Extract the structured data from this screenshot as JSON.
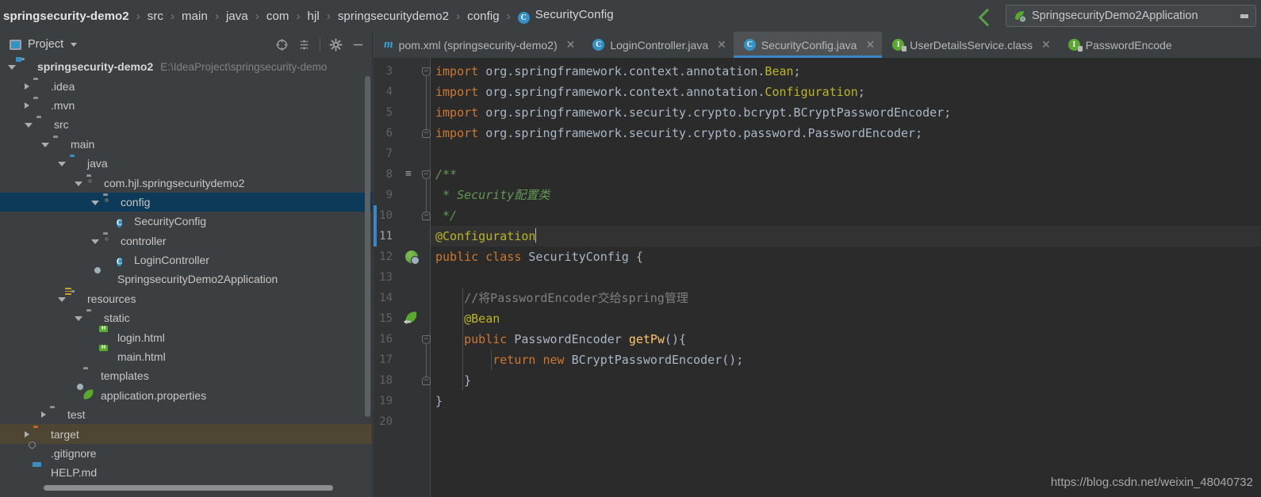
{
  "window": {
    "breadcrumb": [
      {
        "label": "springsecurity-demo2",
        "bold": true,
        "icon": null
      },
      {
        "label": "src",
        "bold": false,
        "icon": null
      },
      {
        "label": "main",
        "bold": false,
        "icon": null
      },
      {
        "label": "java",
        "bold": false,
        "icon": null
      },
      {
        "label": "com",
        "bold": false,
        "icon": null
      },
      {
        "label": "hjl",
        "bold": false,
        "icon": null
      },
      {
        "label": "springsecuritydemo2",
        "bold": false,
        "icon": null
      },
      {
        "label": "config",
        "bold": false,
        "icon": null
      },
      {
        "label": "SecurityConfig",
        "bold": false,
        "icon": "java-class-icon"
      }
    ],
    "separator": "›",
    "run_config": {
      "name": "SpringsecurityDemo2Application",
      "icon": "spring-boot-leaf-icon",
      "dropdown_icon": "chevron-down-icon"
    },
    "back_arrow_icon": "back-arrow-icon"
  },
  "project_panel": {
    "title": "Project",
    "title_icon": "project-window-icon",
    "title_caret": "chevron-down-icon",
    "actions": [
      {
        "name": "select-opened-file-icon",
        "glyph": "⊕"
      },
      {
        "name": "collapse-all-icon",
        "glyph": "≡"
      },
      {
        "name": "settings-gear-icon",
        "glyph": "⚙"
      },
      {
        "name": "hide-panel-icon",
        "glyph": "—"
      }
    ],
    "tree": [
      {
        "label": "springsecurity-demo2",
        "path": "E:\\IdeaProject\\springsecurity-demo",
        "indent": 0,
        "arrow": "open",
        "icon": "module-folder-icon",
        "bold": true,
        "state": "normal"
      },
      {
        "label": ".idea",
        "path": "",
        "indent": 1,
        "arrow": "closed",
        "icon": "folder-icon",
        "bold": false,
        "state": "normal"
      },
      {
        "label": ".mvn",
        "path": "",
        "indent": 1,
        "arrow": "closed",
        "icon": "folder-icon",
        "bold": false,
        "state": "normal"
      },
      {
        "label": "src",
        "path": "",
        "indent": 1,
        "arrow": "open",
        "icon": "folder-icon",
        "bold": false,
        "state": "normal"
      },
      {
        "label": "main",
        "path": "",
        "indent": 2,
        "arrow": "open",
        "icon": "folder-icon",
        "bold": false,
        "state": "normal"
      },
      {
        "label": "java",
        "path": "",
        "indent": 3,
        "arrow": "open",
        "icon": "source-root-folder-icon",
        "bold": false,
        "state": "normal"
      },
      {
        "label": "com.hjl.springsecuritydemo2",
        "path": "",
        "indent": 4,
        "arrow": "open",
        "icon": "package-folder-icon",
        "bold": false,
        "state": "normal"
      },
      {
        "label": "config",
        "path": "",
        "indent": 5,
        "arrow": "open",
        "icon": "package-folder-icon",
        "bold": false,
        "state": "selected"
      },
      {
        "label": "SecurityConfig",
        "path": "",
        "indent": 6,
        "arrow": "none",
        "icon": "java-class-icon",
        "bold": false,
        "state": "normal"
      },
      {
        "label": "controller",
        "path": "",
        "indent": 5,
        "arrow": "open",
        "icon": "package-folder-icon",
        "bold": false,
        "state": "normal"
      },
      {
        "label": "LoginController",
        "path": "",
        "indent": 6,
        "arrow": "none",
        "icon": "java-class-icon",
        "bold": false,
        "state": "normal"
      },
      {
        "label": "SpringsecurityDemo2Application",
        "path": "",
        "indent": 5,
        "arrow": "none",
        "icon": "spring-boot-class-icon",
        "bold": false,
        "state": "normal"
      },
      {
        "label": "resources",
        "path": "",
        "indent": 3,
        "arrow": "open",
        "icon": "resources-folder-icon",
        "bold": false,
        "state": "normal"
      },
      {
        "label": "static",
        "path": "",
        "indent": 4,
        "arrow": "open",
        "icon": "folder-icon",
        "bold": false,
        "state": "normal"
      },
      {
        "label": "login.html",
        "path": "",
        "indent": 5,
        "arrow": "none",
        "icon": "html-file-icon",
        "bold": false,
        "state": "normal"
      },
      {
        "label": "main.html",
        "path": "",
        "indent": 5,
        "arrow": "none",
        "icon": "html-file-icon",
        "bold": false,
        "state": "normal"
      },
      {
        "label": "templates",
        "path": "",
        "indent": 4,
        "arrow": "none",
        "icon": "folder-icon",
        "bold": false,
        "state": "normal"
      },
      {
        "label": "application.properties",
        "path": "",
        "indent": 4,
        "arrow": "none",
        "icon": "spring-properties-icon",
        "bold": false,
        "state": "normal"
      },
      {
        "label": "test",
        "path": "",
        "indent": 2,
        "arrow": "closed",
        "icon": "folder-icon",
        "bold": false,
        "state": "normal"
      },
      {
        "label": "target",
        "path": "",
        "indent": 1,
        "arrow": "closed",
        "icon": "excluded-folder-icon",
        "bold": false,
        "state": "hover"
      },
      {
        "label": ".gitignore",
        "path": "",
        "indent": 1,
        "arrow": "none",
        "icon": "gitignore-file-icon",
        "bold": false,
        "state": "normal"
      },
      {
        "label": "HELP.md",
        "path": "",
        "indent": 1,
        "arrow": "none",
        "icon": "markdown-file-icon",
        "bold": false,
        "state": "normal"
      }
    ]
  },
  "editor": {
    "tabs": [
      {
        "label": "pom.xml (springsecurity-demo2)",
        "icon": "maven-icon",
        "active": false,
        "closable": true
      },
      {
        "label": "LoginController.java",
        "icon": "java-class-icon",
        "active": false,
        "closable": true
      },
      {
        "label": "SecurityConfig.java",
        "icon": "java-class-icon",
        "active": true,
        "closable": true
      },
      {
        "label": "UserDetailsService.class",
        "icon": "java-interface-locked-icon",
        "active": false,
        "closable": true
      },
      {
        "label": "PasswordEncode",
        "icon": "java-interface-locked-icon",
        "active": false,
        "closable": false
      }
    ],
    "first_line_number": 3,
    "last_line_number": 20,
    "current_line": 11,
    "lines": [
      {
        "n": 3,
        "tokens": [
          [
            "k",
            "import "
          ],
          [
            "s",
            "org.springframework.context.annotation."
          ],
          [
            "an",
            "Bean"
          ],
          [
            "s",
            ";"
          ]
        ]
      },
      {
        "n": 4,
        "tokens": [
          [
            "k",
            "import "
          ],
          [
            "s",
            "org.springframework.context.annotation."
          ],
          [
            "an",
            "Configuration"
          ],
          [
            "s",
            ";"
          ]
        ]
      },
      {
        "n": 5,
        "tokens": [
          [
            "k",
            "import "
          ],
          [
            "s",
            "org.springframework.security.crypto.bcrypt.BCryptPasswordEncoder;"
          ]
        ]
      },
      {
        "n": 6,
        "tokens": [
          [
            "k",
            "import "
          ],
          [
            "s",
            "org.springframework.security.crypto.password.PasswordEncoder;"
          ]
        ]
      },
      {
        "n": 7,
        "tokens": []
      },
      {
        "n": 8,
        "tokens": [
          [
            "cm",
            "/**"
          ]
        ]
      },
      {
        "n": 9,
        "tokens": [
          [
            "cm",
            " * Security配置类"
          ]
        ]
      },
      {
        "n": 10,
        "tokens": [
          [
            "cm",
            " */"
          ]
        ]
      },
      {
        "n": 11,
        "tokens": [
          [
            "an",
            "@Configuration"
          ]
        ]
      },
      {
        "n": 12,
        "tokens": [
          [
            "k",
            "public class "
          ],
          [
            "s",
            "SecurityConfig {"
          ]
        ]
      },
      {
        "n": 13,
        "tokens": []
      },
      {
        "n": 14,
        "tokens": [
          [
            "cm2",
            "    //将PasswordEncoder交给spring管理"
          ]
        ]
      },
      {
        "n": 15,
        "tokens": [
          [
            "an",
            "    @Bean"
          ]
        ]
      },
      {
        "n": 16,
        "tokens": [
          [
            "k",
            "    public "
          ],
          [
            "s",
            "PasswordEncoder "
          ],
          [
            "mth",
            "getPw"
          ],
          [
            "s",
            "(){"
          ]
        ]
      },
      {
        "n": 17,
        "tokens": [
          [
            "k",
            "        return new "
          ],
          [
            "s",
            "BCryptPasswordEncoder();"
          ]
        ]
      },
      {
        "n": 18,
        "tokens": [
          [
            "s",
            "    }"
          ]
        ]
      },
      {
        "n": 19,
        "tokens": [
          [
            "s",
            "}"
          ]
        ]
      },
      {
        "n": 20,
        "tokens": []
      }
    ],
    "gutter_icons": [
      {
        "line": 8,
        "name": "javadoc-marker-icon",
        "type": "doc"
      },
      {
        "line": 12,
        "name": "spring-bean-class-icon",
        "type": "bean"
      },
      {
        "line": 15,
        "name": "spring-bean-method-icon",
        "type": "leaf"
      }
    ],
    "fold_markers": [
      {
        "line": 3,
        "name": "fold-region-start-icon",
        "kind": "top"
      },
      {
        "line": 6,
        "name": "fold-region-end-icon",
        "kind": "bot"
      },
      {
        "line": 8,
        "name": "fold-region-start-icon",
        "kind": "top"
      },
      {
        "line": 10,
        "name": "fold-region-end-icon",
        "kind": "bot"
      },
      {
        "line": 16,
        "name": "fold-region-start-icon",
        "kind": "top"
      },
      {
        "line": 18,
        "name": "fold-region-end-icon",
        "kind": "bot"
      }
    ],
    "watermark": "https://blog.csdn.net/weixin_48040732"
  },
  "colors": {
    "panel_bg": "#3c3f41",
    "editor_bg": "#2b2b2b",
    "gutter_bg": "#313335",
    "selection_blue": "#0d3a58",
    "hover_brown": "#4e4633",
    "tab_active": "#4e5254",
    "accent_blue": "#3b86c7",
    "keyword_orange": "#cc7832",
    "annotation_yellow": "#bbb529",
    "string_green": "#629755",
    "method_gold": "#ffc66d",
    "text_grey": "#a9b7c6"
  }
}
